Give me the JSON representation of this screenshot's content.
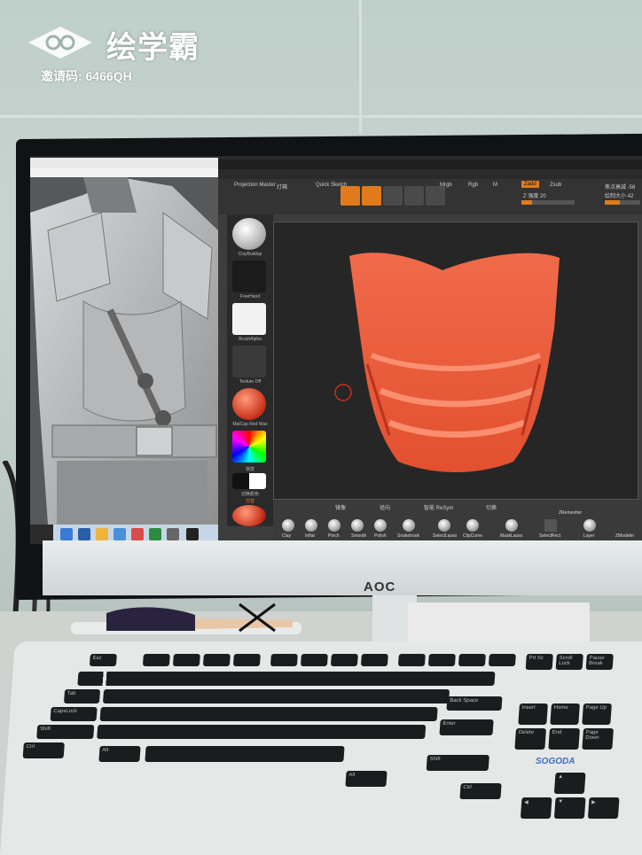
{
  "watermark": {
    "brand": "绘学霸",
    "invite_code": "邀请码: 6466QH"
  },
  "monitor": {
    "brand": "AOC"
  },
  "zbrush": {
    "toolbar": {
      "projection_master": "Projection Master",
      "lightbox": "灯箱",
      "quick_sketch": "Quick Sketch",
      "mrgb": "Mrgb",
      "rgb": "Rgb",
      "m": "M",
      "zadd": "Zadd",
      "zsub": "Zsub",
      "z_intensity": "Z 强度 20",
      "focal_shift": "焦点衰减 -56",
      "draw_size": "绘制大小 42"
    },
    "tray": {
      "clay_buildup": "ClayBuildup",
      "freehand": "FreeHand",
      "brush_alpha": "BrushAlpha",
      "texture_off": "Texture Off",
      "material": "MatCap Red Wax",
      "gradient": "渐变",
      "switch_color": "切换颜色",
      "alternate": "交替"
    },
    "bottom": {
      "brushes": [
        "Clay",
        "Inflat",
        "Pinch",
        "Smooth",
        "Polish",
        "Snakehook",
        "SelectLasso",
        "ClipCurve",
        "MaskLasso",
        "SelectRect",
        "Layer",
        "ZRemesher",
        "ZModeler"
      ],
      "labels": [
        "镜像",
        "径向",
        "智能 ReSym",
        "切换"
      ]
    }
  },
  "keyboard": {
    "brand": "SOGODA",
    "keys": {
      "esc": "Esc",
      "tab": "Tab",
      "caps": "CapsLock",
      "shift": "Shift",
      "ctrl": "Ctrl",
      "alt": "Alt",
      "backspace": "Back Space",
      "enter": "Enter",
      "insert": "Insert",
      "home": "Home",
      "page_up": "Page Up",
      "delete": "Delete",
      "end": "End",
      "page_down": "Page Down",
      "print": "Prt Sc",
      "scroll": "Scroll Lock",
      "pause": "Pause Break"
    }
  },
  "colors": {
    "accent": "#e07a1a",
    "mesh": "#e2502f",
    "wall": "#c3d0cc"
  }
}
